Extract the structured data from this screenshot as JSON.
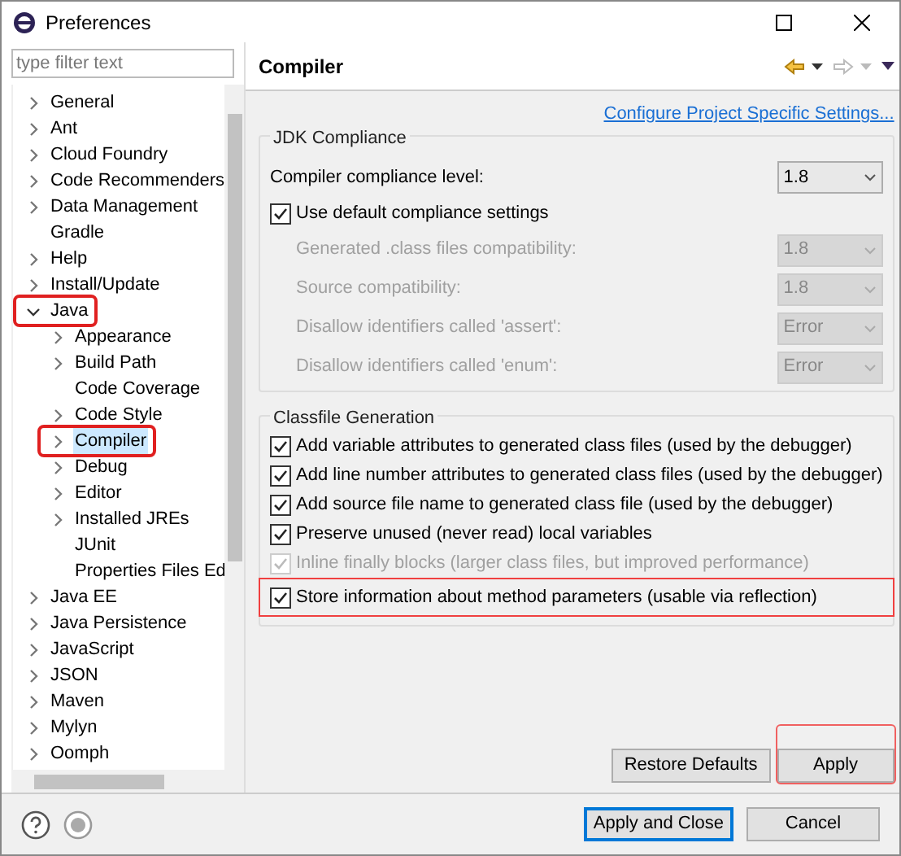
{
  "window": {
    "title": "Preferences"
  },
  "filter": {
    "placeholder": "type filter text"
  },
  "tree": [
    {
      "label": "General",
      "expanded": false,
      "selected": false,
      "highlighted": false
    },
    {
      "label": "Ant",
      "expanded": false,
      "selected": false,
      "highlighted": false
    },
    {
      "label": "Cloud Foundry",
      "expanded": false,
      "selected": false,
      "highlighted": false
    },
    {
      "label": "Code Recommenders",
      "expanded": false,
      "selected": false,
      "highlighted": false
    },
    {
      "label": "Data Management",
      "expanded": false,
      "selected": false,
      "highlighted": false
    },
    {
      "label": "Gradle",
      "selected": false,
      "highlighted": false
    },
    {
      "label": "Help",
      "expanded": false,
      "selected": false,
      "highlighted": false
    },
    {
      "label": "Install/Update",
      "expanded": false,
      "selected": false,
      "highlighted": false
    },
    {
      "label": "Java",
      "expanded": true,
      "selected": false,
      "highlighted": true,
      "children": [
        {
          "label": "Appearance",
          "expanded": false,
          "selected": false,
          "highlighted": false
        },
        {
          "label": "Build Path",
          "expanded": false,
          "selected": false,
          "highlighted": false
        },
        {
          "label": "Code Coverage",
          "selected": false,
          "highlighted": false
        },
        {
          "label": "Code Style",
          "expanded": false,
          "selected": false,
          "highlighted": false
        },
        {
          "label": "Compiler",
          "expanded": false,
          "selected": true,
          "highlighted": true
        },
        {
          "label": "Debug",
          "expanded": false,
          "selected": false,
          "highlighted": false
        },
        {
          "label": "Editor",
          "expanded": false,
          "selected": false,
          "highlighted": false
        },
        {
          "label": "Installed JREs",
          "expanded": false,
          "selected": false,
          "highlighted": false
        },
        {
          "label": "JUnit",
          "selected": false,
          "highlighted": false
        },
        {
          "label": "Properties Files Ed",
          "selected": false,
          "highlighted": false
        }
      ]
    },
    {
      "label": "Java EE",
      "expanded": false,
      "selected": false,
      "highlighted": false
    },
    {
      "label": "Java Persistence",
      "expanded": false,
      "selected": false,
      "highlighted": false
    },
    {
      "label": "JavaScript",
      "expanded": false,
      "selected": false,
      "highlighted": false
    },
    {
      "label": "JSON",
      "expanded": false,
      "selected": false,
      "highlighted": false
    },
    {
      "label": "Maven",
      "expanded": false,
      "selected": false,
      "highlighted": false
    },
    {
      "label": "Mylyn",
      "expanded": false,
      "selected": false,
      "highlighted": false
    },
    {
      "label": "Oomph",
      "expanded": false,
      "selected": false,
      "highlighted": false
    }
  ],
  "page": {
    "title": "Compiler",
    "link": "Configure Project Specific Settings...",
    "jdk": {
      "title": "JDK Compliance",
      "level": {
        "label": "Compiler compliance level:",
        "value": "1.8"
      },
      "use_default": {
        "label": "Use default compliance settings",
        "checked": true
      },
      "settings": [
        {
          "label": "Generated .class files compatibility:",
          "value": "1.8",
          "disabled": true
        },
        {
          "label": "Source compatibility:",
          "value": "1.8",
          "disabled": true
        },
        {
          "label": "Disallow identifiers called 'assert':",
          "value": "Error",
          "disabled": true
        },
        {
          "label": "Disallow identifiers called 'enum':",
          "value": "Error",
          "disabled": true
        }
      ]
    },
    "classfile": {
      "title": "Classfile Generation",
      "options": [
        {
          "label": "Add variable attributes to generated class files (used by the debugger)",
          "checked": true,
          "disabled": false,
          "highlighted": false
        },
        {
          "label": "Add line number attributes to generated class files (used by the debugger)",
          "checked": true,
          "disabled": false,
          "highlighted": false
        },
        {
          "label": "Add source file name to generated class file (used by the debugger)",
          "checked": true,
          "disabled": false,
          "highlighted": false
        },
        {
          "label": "Preserve unused (never read) local variables",
          "checked": true,
          "disabled": false,
          "highlighted": false
        },
        {
          "label": "Inline finally blocks (larger class files, but improved performance)",
          "checked": true,
          "disabled": true,
          "highlighted": false
        },
        {
          "label": "Store information about method parameters (usable via reflection)",
          "checked": true,
          "disabled": false,
          "highlighted": true
        }
      ]
    },
    "buttons": [
      {
        "label": "Restore Defaults",
        "highlighted": false
      },
      {
        "label": "Apply",
        "highlighted": true
      }
    ]
  },
  "footer": {
    "buttons": [
      {
        "label": "Apply and Close",
        "default": true
      },
      {
        "label": "Cancel",
        "default": false
      }
    ]
  }
}
